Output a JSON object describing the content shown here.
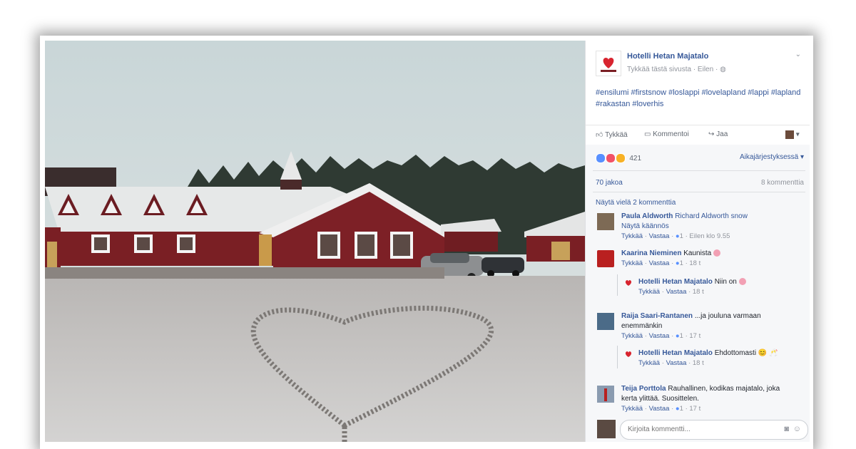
{
  "page": {
    "name": "Hotelli Hetan Majatalo",
    "sub_like": "Tykkää tästä sivusta",
    "sub_time": "· Eilen ·",
    "post_text": "#ensilumi #firstsnow #loslappi #lovelapland #lappi #lapland #rakastan #loverhis"
  },
  "actions": {
    "like": "Tykkää",
    "comment": "Kommentoi",
    "share": "Jaa"
  },
  "stats": {
    "reaction_count": "421",
    "sort_label": "Aikajärjestyksessä ▾",
    "shares": "70 jakoa",
    "comments": "8 kommenttia",
    "more_comments": "Näytä vielä 2 kommenttia"
  },
  "comments": [
    {
      "name": "Paula Aldworth",
      "text": "Richard Aldworth snow",
      "text2": "Näytä käännös",
      "like": "Tykkää",
      "reply": "Vastaa",
      "count": "1",
      "time": "· Eilen klo 9.55"
    },
    {
      "name": "Kaarina Nieminen",
      "text": "Kaunista",
      "like": "Tykkää",
      "reply": "Vastaa",
      "count": "1",
      "time": "· 18 t"
    },
    {
      "name": "Hotelli Hetan Majatalo",
      "text": "Niin on",
      "like": "Tykkää",
      "reply": "Vastaa",
      "time": "· 18 t"
    },
    {
      "name": "Raija Saari-Rantanen",
      "text": "...ja jouluna varmaan",
      "text2": "enemmänkin",
      "like": "Tykkää",
      "reply": "Vastaa",
      "count": "1",
      "time": "· 17 t"
    },
    {
      "name": "Hotelli Hetan Majatalo",
      "text": "Ehdottomasti 😊 🥂",
      "like": "Tykkää",
      "reply": "Vastaa",
      "time": "· 18 t"
    },
    {
      "name": "Teija Porttola",
      "text": "Rauhallinen, kodikas majatalo, joka",
      "text2": "kerta ylittää. Suosittelen.",
      "like": "Tykkää",
      "reply": "Vastaa",
      "count": "1",
      "time": "· 17 t"
    }
  ],
  "write": {
    "placeholder": "Kirjoita kommentti..."
  },
  "colors": {
    "link": "#365899",
    "meta": "#90949c",
    "barn_red": "#7a1f24"
  }
}
